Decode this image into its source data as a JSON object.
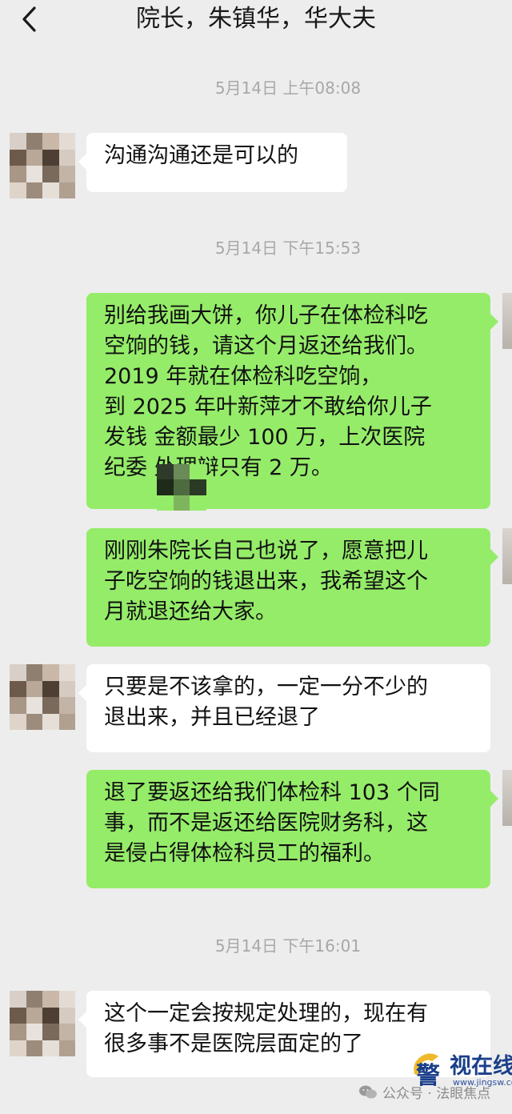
{
  "header": {
    "title": "院长，朱镇华，华大夫"
  },
  "timestamps": [
    "5月14日 上午08:08",
    "5月14日 下午15:53",
    "5月14日 下午16:01"
  ],
  "messages": [
    {
      "side": "left",
      "lines": [
        "沟通沟通还是可以的"
      ]
    },
    {
      "side": "right",
      "lines": [
        "别给我画大饼，你儿子在体检科吃",
        "空饷的钱，请这个月返还给我们。",
        "2019 年就在体检科吃空饷，",
        "到 2025 年叶新萍才不敢给你儿子",
        "发钱   金额最少 100 万，上次医院",
        "纪委       处理辩只有 2 万。"
      ]
    },
    {
      "side": "right",
      "lines": [
        "刚刚朱院长自己也说了，愿意把儿",
        "子吃空饷的钱退出来，我希望这个",
        "月就退还给大家。"
      ]
    },
    {
      "side": "left",
      "lines": [
        "只要是不该拿的，一定一分不少的",
        "退出来，并且已经退了"
      ]
    },
    {
      "side": "right",
      "lines": [
        "退了要返还给我们体检科 103 个同",
        "事，而不是返还给医院财务科，这",
        "是侵占得体检科员工的福利。"
      ]
    },
    {
      "side": "left",
      "lines": [
        "这个一定会按规定处理的，现在有",
        "很多事不是医院层面定的了"
      ]
    }
  ],
  "watermark": {
    "account": "公众号 · 法眼焦点",
    "brand": "视在线",
    "url": "www.jingsw.com"
  },
  "icons": {
    "back": "chevron-left-icon",
    "wechat": "wechat-icon"
  }
}
